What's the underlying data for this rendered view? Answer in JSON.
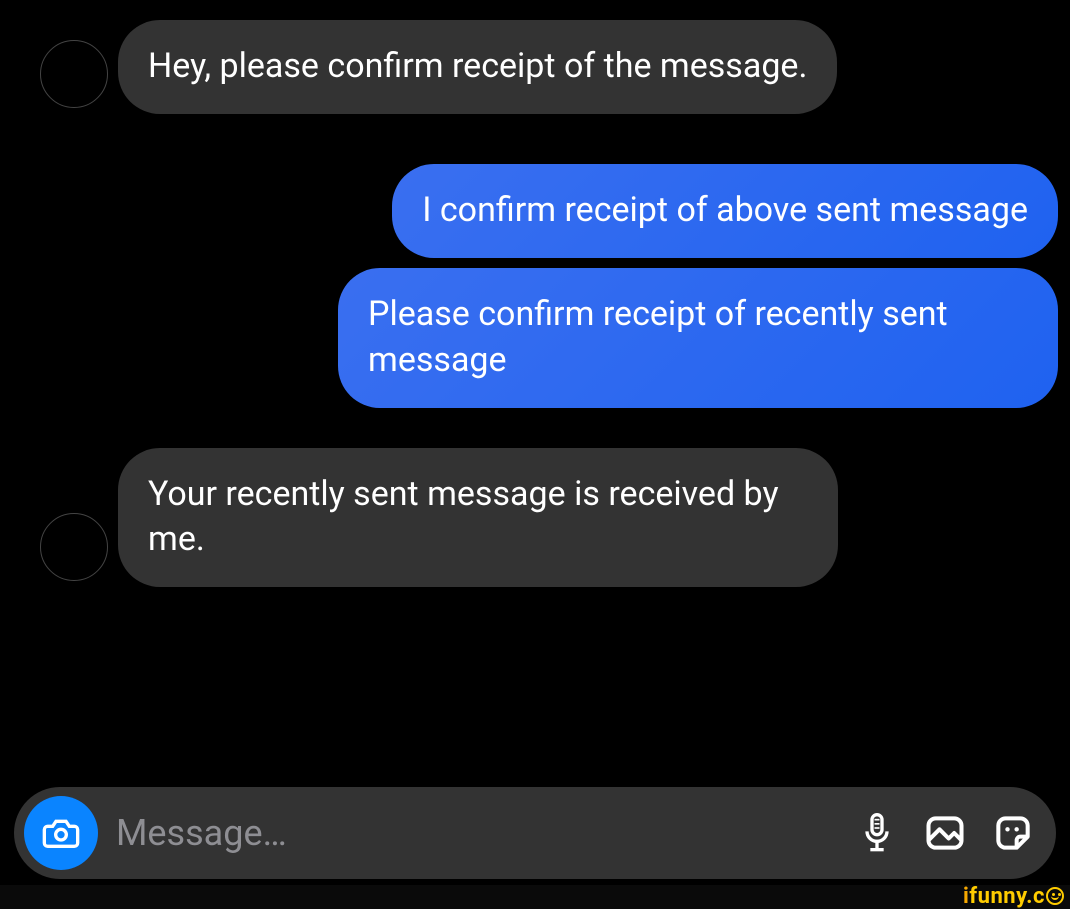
{
  "messages": [
    {
      "side": "incoming",
      "text": "Hey, please confirm receipt of the message."
    },
    {
      "side": "outgoing",
      "text": "I confirm receipt of above sent message"
    },
    {
      "side": "outgoing",
      "text": "Please confirm receipt of recently sent message"
    },
    {
      "side": "incoming",
      "text": "Your recently sent message is received by me."
    }
  ],
  "input": {
    "placeholder": "Message…"
  },
  "watermark": {
    "text": "ifunny.co"
  },
  "colors": {
    "outgoing_bubble": "#1f62f0",
    "incoming_bubble": "#333333",
    "background": "#000000",
    "camera_button": "#0a84ff"
  }
}
